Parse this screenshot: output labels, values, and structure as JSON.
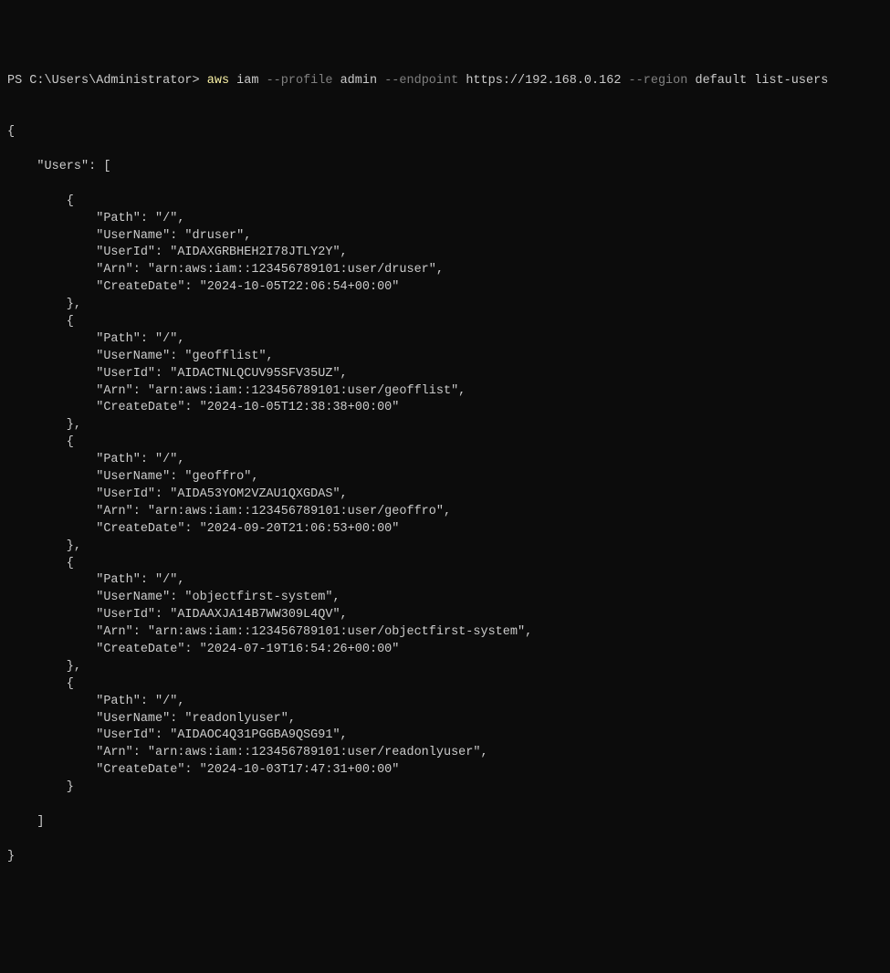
{
  "prompt": {
    "ps_path": "PS C:\\Users\\Administrator> ",
    "cmd_aws": "aws ",
    "cmd_service": "iam ",
    "flag_profile": "--profile ",
    "val_profile": "admin ",
    "flag_endpoint": "--endpoint ",
    "val_endpoint": "https://192.168.0.162 ",
    "flag_region": "--region ",
    "val_region": "default ",
    "cmd_action": "list-users"
  },
  "output": {
    "open_brace": "{",
    "users_key": "    \"Users\": [",
    "users": [
      {
        "open": "        {",
        "path": "            \"Path\": \"/\",",
        "username": "            \"UserName\": \"druser\",",
        "userid": "            \"UserId\": \"AIDAXGRBHEH2I78JTLY2Y\",",
        "arn": "            \"Arn\": \"arn:aws:iam::123456789101:user/druser\",",
        "createdate": "            \"CreateDate\": \"2024-10-05T22:06:54+00:00\"",
        "close": "        },"
      },
      {
        "open": "        {",
        "path": "            \"Path\": \"/\",",
        "username": "            \"UserName\": \"geofflist\",",
        "userid": "            \"UserId\": \"AIDACTNLQCUV95SFV35UZ\",",
        "arn": "            \"Arn\": \"arn:aws:iam::123456789101:user/geofflist\",",
        "createdate": "            \"CreateDate\": \"2024-10-05T12:38:38+00:00\"",
        "close": "        },"
      },
      {
        "open": "        {",
        "path": "            \"Path\": \"/\",",
        "username": "            \"UserName\": \"geoffro\",",
        "userid": "            \"UserId\": \"AIDA53YOM2VZAU1QXGDAS\",",
        "arn": "            \"Arn\": \"arn:aws:iam::123456789101:user/geoffro\",",
        "createdate": "            \"CreateDate\": \"2024-09-20T21:06:53+00:00\"",
        "close": "        },"
      },
      {
        "open": "        {",
        "path": "            \"Path\": \"/\",",
        "username": "            \"UserName\": \"objectfirst-system\",",
        "userid": "            \"UserId\": \"AIDAAXJA14B7WW309L4QV\",",
        "arn": "            \"Arn\": \"arn:aws:iam::123456789101:user/objectfirst-system\",",
        "createdate": "            \"CreateDate\": \"2024-07-19T16:54:26+00:00\"",
        "close": "        },"
      },
      {
        "open": "        {",
        "path": "            \"Path\": \"/\",",
        "username": "            \"UserName\": \"readonlyuser\",",
        "userid": "            \"UserId\": \"AIDAOC4Q31PGGBA9QSG91\",",
        "arn": "            \"Arn\": \"arn:aws:iam::123456789101:user/readonlyuser\",",
        "createdate": "            \"CreateDate\": \"2024-10-03T17:47:31+00:00\"",
        "close": "        }"
      }
    ],
    "close_array": "    ]",
    "close_brace": "}"
  }
}
